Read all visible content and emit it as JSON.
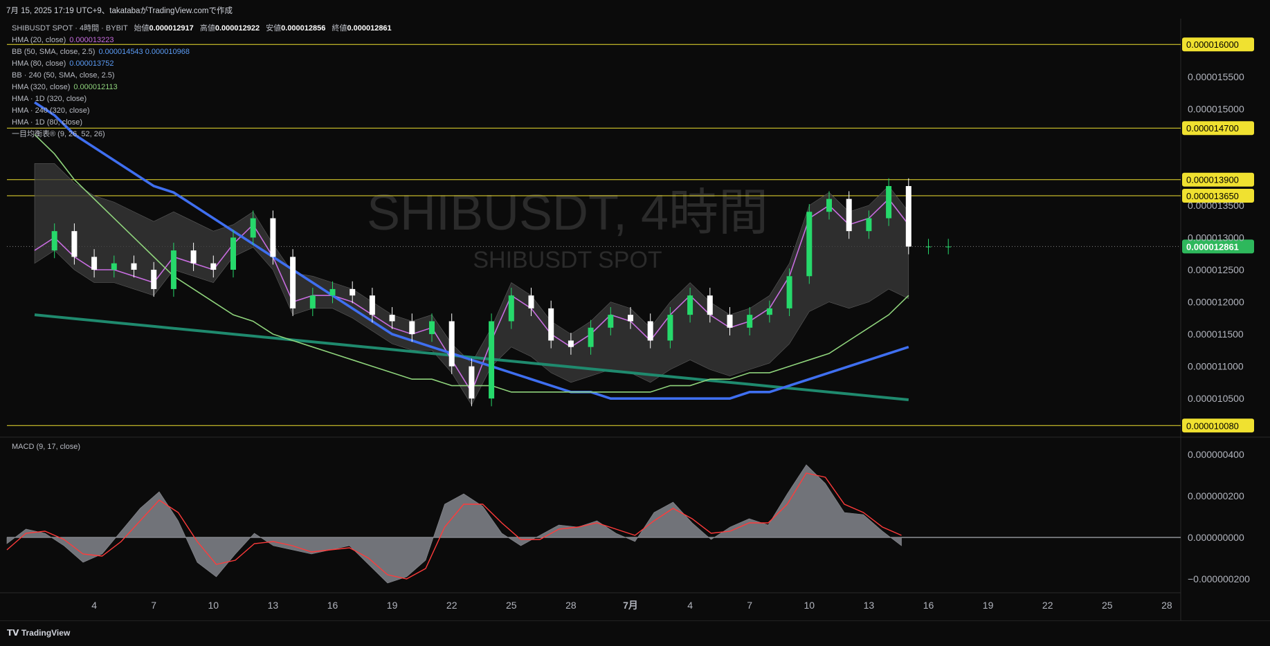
{
  "header": {
    "timestamp": "7月 15, 2025 17:19 UTC+9、takatabaがTradingView.comで作成"
  },
  "watermark": {
    "line1": "SHIBUSDT, 4時間",
    "line2": "SHIBUSDT SPOT"
  },
  "legend": {
    "symbol": "SHIBUSDT SPOT · 4時間 · BYBIT",
    "ohlc": [
      {
        "label": "始値",
        "value": "0.000012917"
      },
      {
        "label": "高値",
        "value": "0.000012922"
      },
      {
        "label": "安値",
        "value": "0.000012856"
      },
      {
        "label": "終値",
        "value": "0.000012861"
      }
    ],
    "indicators": [
      {
        "label": "HMA (20, close)",
        "value": "0.000013223",
        "color": "#c86de0"
      },
      {
        "label": "BB (50, SMA, close, 2.5)",
        "value": "0.000014543  0.000010968",
        "color": "#5b9cf6"
      },
      {
        "label": "HMA (80, close)",
        "value": "0.000013752",
        "color": "#5b9cf6"
      },
      {
        "label": "BB · 240 (50, SMA, close, 2.5)",
        "value": "",
        "color": "#5b9cf6"
      },
      {
        "label": "HMA (320, close)",
        "value": "0.000012113",
        "color": "#8fd47c"
      },
      {
        "label": "HMA · 1D (320, close)",
        "value": "",
        "color": "#fff"
      },
      {
        "label": "HMA · 240 (320, close)",
        "value": "",
        "color": "#fff"
      },
      {
        "label": "HMA · 1D (80, close)",
        "value": "",
        "color": "#fff"
      },
      {
        "label": "一目均衡表® (9, 26, 52, 26)",
        "value": "",
        "color": "#fff"
      }
    ]
  },
  "macd_label": "MACD (9, 17, close)",
  "footer": {
    "logo": "TradingView"
  },
  "colors": {
    "bg": "#0b0b0b",
    "level": "#f0e130",
    "up": "#26d96b",
    "down": "#ffffff",
    "hma20": "#c86de0",
    "hma80": "#3f6ff0",
    "hma320": "#8fd47c",
    "ema_long": "#1f8a6e",
    "bb": "#5b9cf6",
    "cloud": "#3a3a3a",
    "macd_signal": "#ff3b3b",
    "macd_hist": "#7d7f86"
  },
  "chart_data": [
    {
      "type": "line",
      "title": "SHIBUSDT, 4時間",
      "ylim": [
        9.9e-06,
        1.64e-05
      ],
      "y_ticks": [
        "0.000010500",
        "0.000011000",
        "0.000011500",
        "0.000012000",
        "0.000012500",
        "0.000013000",
        "0.000013500",
        "0.000015000",
        "0.000015500"
      ],
      "y_tick_values": [
        1.05e-05,
        1.1e-05,
        1.15e-05,
        1.2e-05,
        1.25e-05,
        1.3e-05,
        1.35e-05,
        1.5e-05,
        1.55e-05
      ],
      "x_ticks": [
        "4",
        "7",
        "10",
        "13",
        "16",
        "19",
        "22",
        "25",
        "28",
        "7月",
        "4",
        "7",
        "10",
        "13",
        "16",
        "19",
        "22",
        "25",
        "28"
      ],
      "x_tick_day_index": [
        3,
        6,
        9,
        12,
        15,
        18,
        21,
        24,
        27,
        30,
        33,
        36,
        39,
        42,
        45,
        48,
        51,
        54,
        57
      ],
      "horizontal_levels": [
        1.6e-05,
        1.47e-05,
        1.39e-05,
        1.365e-05,
        1.00799e-05
      ],
      "level_labels": [
        "0.000016000",
        "0.000014700",
        "0.000013900",
        "0.000013650",
        "0.000010080"
      ],
      "last_price": "0.000012861",
      "last_price_value": 1.2861e-05,
      "close_series_days": [
        0,
        1,
        2,
        3,
        4,
        5,
        6,
        7,
        8,
        9,
        10,
        11,
        12,
        13,
        14,
        15,
        16,
        17,
        18,
        19,
        20,
        21,
        22,
        23,
        24,
        25,
        26,
        27,
        28,
        29,
        30,
        31,
        32,
        33,
        34,
        35,
        36,
        37,
        38,
        39,
        40,
        41,
        42,
        43,
        44,
        45,
        46
      ],
      "close_series": [
        1.28e-05,
        1.31e-05,
        1.27e-05,
        1.25e-05,
        1.26e-05,
        1.25e-05,
        1.22e-05,
        1.28e-05,
        1.26e-05,
        1.25e-05,
        1.3e-05,
        1.33e-05,
        1.27e-05,
        1.19e-05,
        1.21e-05,
        1.22e-05,
        1.21e-05,
        1.18e-05,
        1.17e-05,
        1.15e-05,
        1.17e-05,
        1.1e-05,
        1.05e-05,
        1.17e-05,
        1.21e-05,
        1.19e-05,
        1.14e-05,
        1.13e-05,
        1.16e-05,
        1.18e-05,
        1.17e-05,
        1.14e-05,
        1.18e-05,
        1.21e-05,
        1.18e-05,
        1.16e-05,
        1.18e-05,
        1.19e-05,
        1.24e-05,
        1.34e-05,
        1.36e-05,
        1.31e-05,
        1.33e-05,
        1.38e-05,
        1.286e-05,
        1.286e-05,
        1.286e-05
      ],
      "series": [
        {
          "name": "HMA (20, close)",
          "values": [
            1.28e-05,
            1.3e-05,
            1.27e-05,
            1.25e-05,
            1.25e-05,
            1.24e-05,
            1.23e-05,
            1.27e-05,
            1.26e-05,
            1.25e-05,
            1.29e-05,
            1.32e-05,
            1.27e-05,
            1.2e-05,
            1.21e-05,
            1.21e-05,
            1.2e-05,
            1.18e-05,
            1.16e-05,
            1.15e-05,
            1.16e-05,
            1.11e-05,
            1.06e-05,
            1.14e-05,
            1.21e-05,
            1.19e-05,
            1.15e-05,
            1.13e-05,
            1.15e-05,
            1.18e-05,
            1.17e-05,
            1.14e-05,
            1.18e-05,
            1.21e-05,
            1.18e-05,
            1.16e-05,
            1.17e-05,
            1.19e-05,
            1.24e-05,
            1.33e-05,
            1.35e-05,
            1.32e-05,
            1.33e-05,
            1.36e-05,
            1.32e-05
          ]
        },
        {
          "name": "HMA (80, close)",
          "values": [
            1.51e-05,
            1.49e-05,
            1.46e-05,
            1.44e-05,
            1.42e-05,
            1.4e-05,
            1.38e-05,
            1.37e-05,
            1.35e-05,
            1.33e-05,
            1.31e-05,
            1.29e-05,
            1.27e-05,
            1.25e-05,
            1.23e-05,
            1.21e-05,
            1.19e-05,
            1.17e-05,
            1.15e-05,
            1.14e-05,
            1.13e-05,
            1.12e-05,
            1.11e-05,
            1.1e-05,
            1.09e-05,
            1.08e-05,
            1.07e-05,
            1.06e-05,
            1.06e-05,
            1.05e-05,
            1.05e-05,
            1.05e-05,
            1.05e-05,
            1.05e-05,
            1.05e-05,
            1.05e-05,
            1.06e-05,
            1.06e-05,
            1.07e-05,
            1.08e-05,
            1.09e-05,
            1.1e-05,
            1.11e-05,
            1.12e-05,
            1.13e-05
          ]
        },
        {
          "name": "HMA (320, close)",
          "values": [
            1.46e-05,
            1.43e-05,
            1.39e-05,
            1.36e-05,
            1.33e-05,
            1.3e-05,
            1.27e-05,
            1.24e-05,
            1.22e-05,
            1.2e-05,
            1.18e-05,
            1.17e-05,
            1.15e-05,
            1.14e-05,
            1.13e-05,
            1.12e-05,
            1.11e-05,
            1.1e-05,
            1.09e-05,
            1.08e-05,
            1.08e-05,
            1.07e-05,
            1.07e-05,
            1.07e-05,
            1.06e-05,
            1.06e-05,
            1.06e-05,
            1.06e-05,
            1.06e-05,
            1.06e-05,
            1.06e-05,
            1.06e-05,
            1.07e-05,
            1.07e-05,
            1.08e-05,
            1.08e-05,
            1.09e-05,
            1.09e-05,
            1.1e-05,
            1.11e-05,
            1.12e-05,
            1.14e-05,
            1.16e-05,
            1.18e-05,
            1.21e-05
          ]
        }
      ]
    },
    {
      "type": "area",
      "title": "MACD (9, 17, close)",
      "ylim": [
        -2.5e-07,
        4.5e-07
      ],
      "y_ticks": [
        "0.000000400",
        "0.000000200",
        "0.000000000",
        "−0.000000200"
      ],
      "y_tick_values": [
        4e-07,
        2e-07,
        0,
        -2e-07
      ],
      "macd": [
        -3e-08,
        4e-08,
        2e-08,
        -4e-08,
        -1.2e-07,
        -8e-08,
        3e-08,
        1.4e-07,
        2.2e-07,
        8e-08,
        -1.2e-07,
        -1.9e-07,
        -8e-08,
        2e-08,
        -4e-08,
        -6e-08,
        -8e-08,
        -6e-08,
        -4e-08,
        -1.3e-07,
        -2.2e-07,
        -1.9e-07,
        -1.1e-07,
        1.6e-07,
        2.1e-07,
        1.5e-07,
        2e-08,
        -4e-08,
        1e-08,
        6e-08,
        5e-08,
        8e-08,
        2e-08,
        -2e-08,
        1.2e-07,
        1.7e-07,
        7e-08,
        -1e-08,
        5e-08,
        9e-08,
        6e-08,
        2.1e-07,
        3.5e-07,
        2.6e-07,
        1.2e-07,
        1.1e-07,
        3e-08,
        -4e-08
      ],
      "signal": [
        -6e-08,
        2e-08,
        3e-08,
        -1e-08,
        -8e-08,
        -9e-08,
        -2e-08,
        8e-08,
        1.8e-07,
        1.2e-07,
        -2e-08,
        -1.3e-07,
        -1.1e-07,
        -3e-08,
        -2e-08,
        -4e-08,
        -7e-08,
        -6e-08,
        -5e-08,
        -1e-07,
        -1.8e-07,
        -2e-07,
        -1.5e-07,
        5e-08,
        1.6e-07,
        1.6e-07,
        7e-08,
        -1e-08,
        -1e-08,
        4e-08,
        5e-08,
        7e-08,
        4e-08,
        1e-08,
        8e-08,
        1.4e-07,
        9e-08,
        2e-08,
        3e-08,
        7e-08,
        7e-08,
        1.6e-07,
        3.1e-07,
        2.9e-07,
        1.6e-07,
        1.2e-07,
        5e-08,
        1e-08
      ]
    }
  ]
}
